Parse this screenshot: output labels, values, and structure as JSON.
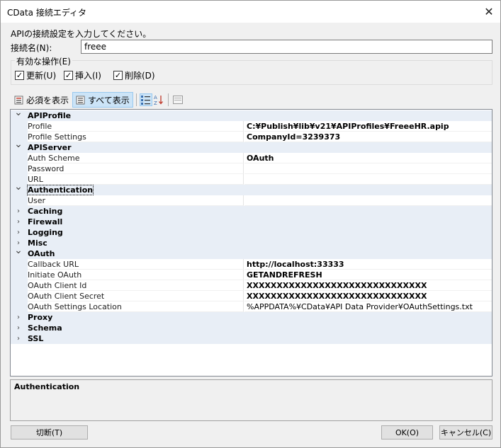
{
  "window": {
    "title": "CData 接続エディタ"
  },
  "form": {
    "prompt": "APIの接続設定を入力してください。",
    "conn_label": "接続名(N):",
    "conn_value": "freee",
    "ops_legend": "有効な操作(E)",
    "ops": [
      {
        "label": "更新(U)",
        "checked": true
      },
      {
        "label": "挿入(I)",
        "checked": true
      },
      {
        "label": "削除(D)",
        "checked": true
      }
    ]
  },
  "toolbar": {
    "required_label": "必須を表示",
    "all_label": "すべて表示"
  },
  "grid": {
    "rows": [
      {
        "kind": "cat",
        "name": "APIProfile",
        "expanded": true
      },
      {
        "kind": "prop",
        "name": "Profile",
        "value": "C:¥Publish¥lib¥v21¥APIProfiles¥FreeeHR.apip"
      },
      {
        "kind": "prop",
        "name": "Profile Settings",
        "value": "CompanyId=3239373"
      },
      {
        "kind": "cat",
        "name": "APIServer",
        "expanded": true
      },
      {
        "kind": "prop",
        "name": "Auth Scheme",
        "value": "OAuth"
      },
      {
        "kind": "prop",
        "name": "Password",
        "value": ""
      },
      {
        "kind": "prop",
        "name": "URL",
        "value": ""
      },
      {
        "kind": "cat",
        "name": "Authentication",
        "expanded": true,
        "focused": true
      },
      {
        "kind": "prop",
        "name": "User",
        "value": ""
      },
      {
        "kind": "cat",
        "name": "Caching",
        "expanded": false
      },
      {
        "kind": "cat",
        "name": "Firewall",
        "expanded": false
      },
      {
        "kind": "cat",
        "name": "Logging",
        "expanded": false
      },
      {
        "kind": "cat",
        "name": "Misc",
        "expanded": false
      },
      {
        "kind": "cat",
        "name": "OAuth",
        "expanded": true
      },
      {
        "kind": "prop",
        "name": "Callback URL",
        "value": "http://localhost:33333"
      },
      {
        "kind": "prop",
        "name": "Initiate OAuth",
        "value": "GETANDREFRESH"
      },
      {
        "kind": "prop",
        "name": "OAuth Client Id",
        "value": "XXXXXXXXXXXXXXXXXXXXXXXXXXXXXX"
      },
      {
        "kind": "prop",
        "name": "OAuth Client Secret",
        "value": "XXXXXXXXXXXXXXXXXXXXXXXXXXXXXX"
      },
      {
        "kind": "prop",
        "name": "OAuth Settings Location",
        "value": "%APPDATA%¥CData¥API Data Provider¥OAuthSettings.txt",
        "normal": true
      },
      {
        "kind": "cat",
        "name": "Proxy",
        "expanded": false
      },
      {
        "kind": "cat",
        "name": "Schema",
        "expanded": false
      },
      {
        "kind": "cat",
        "name": "SSL",
        "expanded": false
      }
    ]
  },
  "description": {
    "title": "Authentication"
  },
  "buttons": {
    "disconnect": "切断(T)",
    "ok": "OK(O)",
    "cancel": "キャンセル(C)"
  }
}
